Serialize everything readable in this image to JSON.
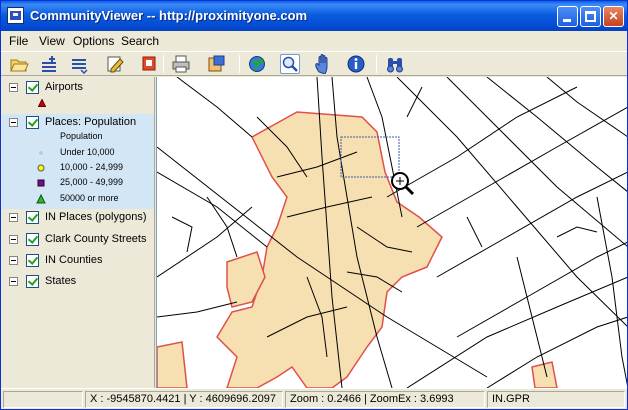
{
  "window": {
    "title": "CommunityViewer -- http://proximityone.com"
  },
  "menu": [
    "File",
    "View",
    "Options",
    "Search"
  ],
  "toolbar": {
    "tools": [
      {
        "name": "open-icon"
      },
      {
        "name": "add-layer-icon"
      },
      {
        "name": "layer-list-icon"
      },
      {
        "name": "edit-icon"
      },
      {
        "name": "stop-icon"
      },
      {
        "name": "print-icon"
      },
      {
        "name": "export-icon"
      },
      {
        "name": "globe-icon"
      },
      {
        "name": "zoom-icon"
      },
      {
        "name": "pan-hand-icon"
      },
      {
        "name": "info-icon"
      },
      {
        "name": "binoculars-icon"
      }
    ]
  },
  "legend": {
    "layers": [
      {
        "label": "Airports",
        "checked": true
      },
      {
        "label": "Places: Population",
        "checked": true
      },
      {
        "label": "IN Places (polygons)",
        "checked": true
      },
      {
        "label": "Clark County Streets",
        "checked": true
      },
      {
        "label": "IN Counties",
        "checked": true
      },
      {
        "label": "States",
        "checked": true
      }
    ],
    "places_header": "Population",
    "places_classes": [
      {
        "label": "Under 10,000",
        "color": "#C8C8C8",
        "symbol": "dot"
      },
      {
        "label": "10,000 - 24,999",
        "color": "#FFFF00",
        "symbol": "circle"
      },
      {
        "label": "25,000 - 49,999",
        "color": "#6A0DAD",
        "symbol": "square"
      },
      {
        "label": "50000 or more",
        "color": "#2EB82E",
        "symbol": "triangle"
      }
    ]
  },
  "colors": {
    "place_fill": "#F6DFB0",
    "place_border": "#E0504A",
    "street": "#000000",
    "zoom_box": "#3F5CA8",
    "airport_symbol": "#CC0000"
  },
  "status": {
    "coords": "X : -9545870.4421 | Y : 4609696.2097",
    "zoom": "Zoom : 0.2466 | ZoomEx : 3.6993",
    "project": "IN.GPR"
  }
}
